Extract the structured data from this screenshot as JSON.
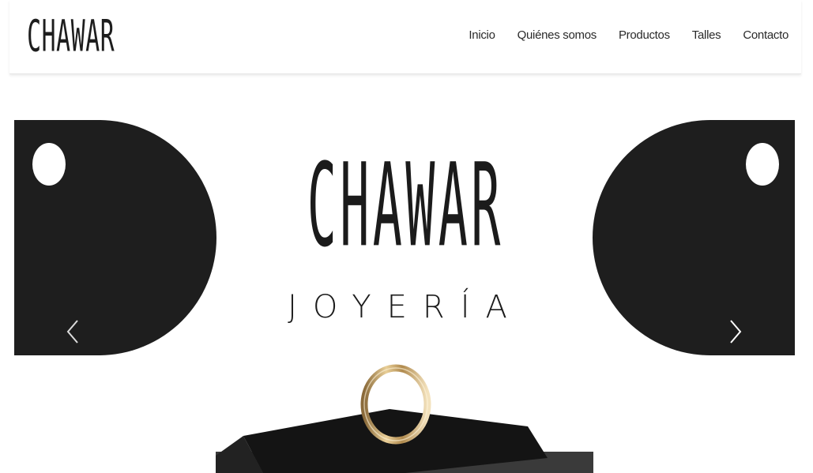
{
  "header": {
    "logo_text": "CHAWAR",
    "nav": [
      {
        "label": "Inicio"
      },
      {
        "label": "Quiénes somos"
      },
      {
        "label": "Productos"
      },
      {
        "label": "Talles"
      },
      {
        "label": "Contacto"
      }
    ]
  },
  "hero": {
    "brand": "CHAWAR",
    "subbrand": "JOYERÍA",
    "prev_icon": "chevron-left-icon",
    "next_icon": "chevron-right-icon"
  },
  "colors": {
    "tag": "#1e1e1e",
    "text": "#1b1b1b",
    "ring_gold": "#d8b77a"
  }
}
